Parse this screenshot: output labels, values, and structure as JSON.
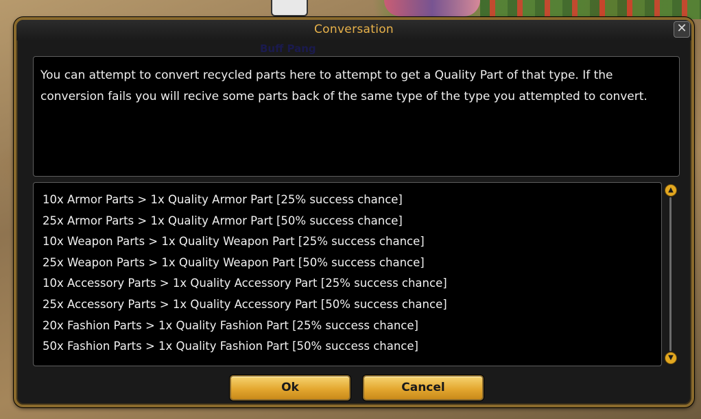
{
  "dialog": {
    "title": "Conversation",
    "close_glyph": "✕",
    "npc_name": "Buff Pang",
    "description": "You can attempt to convert recycled parts here to attempt to get a Quality Part of that type. If the conversion fails you will recive some parts back of the same type of the type you attempted to convert."
  },
  "options": [
    {
      "label": "10x Armor Parts > 1x Quality Armor Part [25% success chance]"
    },
    {
      "label": "25x Armor Parts > 1x Quality Armor Part [50% success chance]"
    },
    {
      "label": "10x Weapon Parts > 1x Quality Weapon Part [25% success chance]"
    },
    {
      "label": "25x Weapon Parts > 1x Quality Weapon Part [50% success chance]"
    },
    {
      "label": "10x Accessory Parts > 1x Quality Accessory Part [25% success chance]"
    },
    {
      "label": "25x Accessory Parts > 1x Quality Accessory Part [50% success chance]"
    },
    {
      "label": "20x Fashion Parts > 1x Quality Fashion Part [25% success chance]"
    },
    {
      "label": "50x Fashion Parts > 1x Quality Fashion Part [50% success chance]"
    }
  ],
  "buttons": {
    "ok_label": "Ok",
    "cancel_label": "Cancel"
  },
  "icons": {
    "close": "close-icon",
    "scroll_up": "chevron-up-icon",
    "scroll_down": "chevron-down-icon"
  },
  "colors": {
    "title": "#e8b24a",
    "frame": "#8a6a2c",
    "button": "#e4a830",
    "text": "#efefef"
  }
}
